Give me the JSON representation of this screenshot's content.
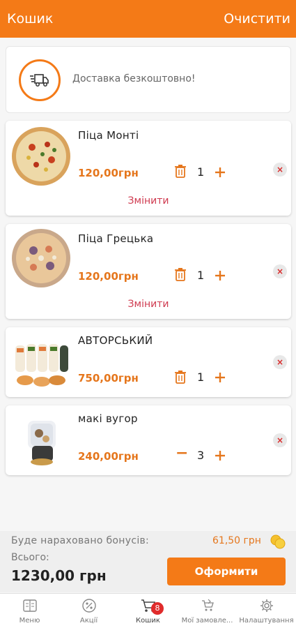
{
  "header": {
    "title": "Кошик",
    "clear_label": "Очистити"
  },
  "delivery": {
    "text": "Доставка безкоштовно!",
    "icon": "truck-icon"
  },
  "cart": {
    "items": [
      {
        "name": "Піца Монті",
        "price": "120,00грн",
        "quantity": "1",
        "change_label": "Змінити",
        "qty_control": "trash"
      },
      {
        "name": "Піца Грецька",
        "price": "120,00грн",
        "quantity": "1",
        "change_label": "Змінити",
        "qty_control": "trash"
      },
      {
        "name": "АВТОРСЬКИЙ",
        "price": "750,00грн",
        "quantity": "1",
        "qty_control": "trash"
      },
      {
        "name": "макі вугор",
        "price": "240,00грн",
        "quantity": "3",
        "qty_control": "minus",
        "minus_label": "−"
      }
    ],
    "remove_glyph": "×"
  },
  "summary": {
    "bonus_label": "Буде нараховано бонусів:",
    "bonus_value": "61,50 грн",
    "total_label": "Всього:",
    "total_value": "1230,00 грн",
    "checkout_label": "Оформити"
  },
  "tabbar": {
    "tabs": [
      {
        "label": "Меню",
        "icon": "menu-book-icon"
      },
      {
        "label": "Акції",
        "icon": "discount-icon"
      },
      {
        "label": "Кошик",
        "icon": "cart-icon",
        "badge": "8",
        "active": true
      },
      {
        "label": "Мої замовле...",
        "icon": "orders-icon"
      },
      {
        "label": "Налаштування",
        "icon": "gear-icon"
      }
    ]
  },
  "colors": {
    "accent": "#f47a17",
    "price": "#e5761c",
    "change": "#cf3a4f",
    "badge": "#e02b2b"
  }
}
